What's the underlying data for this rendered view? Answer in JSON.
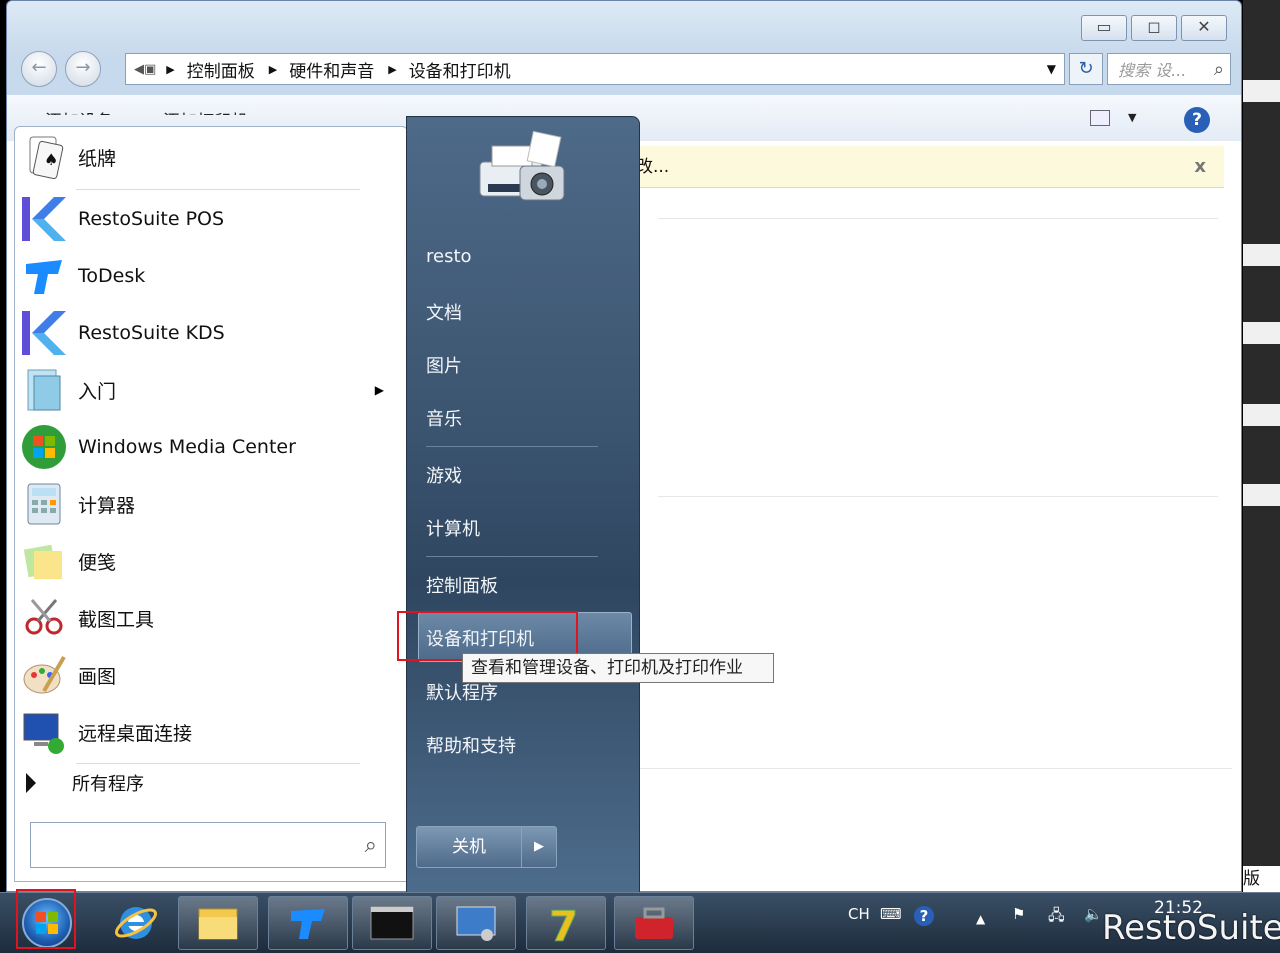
{
  "window": {
    "breadcrumbs": [
      "控制面板",
      "硬件和声音",
      "设备和打印机"
    ],
    "search_placeholder": "搜索 设...",
    "toolbar": {
      "add_device": "添加设备",
      "add_printer": "添加打印机"
    },
    "info_bar_text": "改...",
    "info_bar_close": "x",
    "edge_text": "版"
  },
  "start_menu": {
    "programs": [
      {
        "label": "纸牌",
        "icon": "solitaire-icon"
      },
      {
        "label": "RestoSuite POS",
        "icon": "restosuite-pos-icon"
      },
      {
        "label": "ToDesk",
        "icon": "todesk-icon"
      },
      {
        "label": "RestoSuite KDS",
        "icon": "restosuite-kds-icon"
      },
      {
        "label": "入门",
        "icon": "getting-started-icon"
      },
      {
        "label": "Windows Media Center",
        "icon": "windows-media-center-icon"
      },
      {
        "label": "计算器",
        "icon": "calculator-icon"
      },
      {
        "label": "便笺",
        "icon": "sticky-notes-icon"
      },
      {
        "label": "截图工具",
        "icon": "snipping-tool-icon"
      },
      {
        "label": "画图",
        "icon": "paint-icon"
      },
      {
        "label": "远程桌面连接",
        "icon": "remote-desktop-icon"
      }
    ],
    "all_programs": "所有程序",
    "right_items": [
      "resto",
      "文档",
      "图片",
      "音乐",
      "游戏",
      "计算机",
      "控制面板",
      "设备和打印机",
      "默认程序",
      "帮助和支持"
    ],
    "highlighted": "设备和打印机",
    "tooltip": "查看和管理设备、打印机及打印作业",
    "shutdown": "关机"
  },
  "taskbar": {
    "tray_lang": "CH",
    "time": "21:52",
    "watermark": "RestoSuite"
  }
}
